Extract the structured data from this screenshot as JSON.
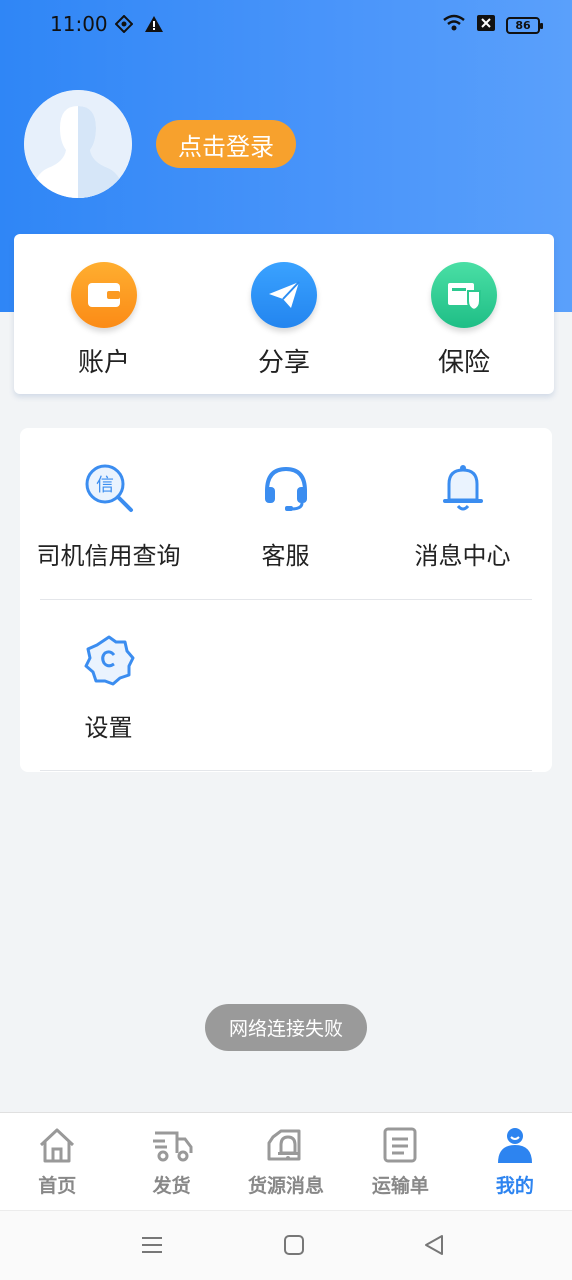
{
  "status_bar": {
    "time": "11:00",
    "battery": "86",
    "icons": [
      "location-icon",
      "warning-icon",
      "wifi-icon",
      "sim-off-icon",
      "battery-icon"
    ]
  },
  "profile": {
    "login_label": "点击登录"
  },
  "quick_actions": [
    {
      "label": "账户",
      "icon": "wallet-icon",
      "color": "#fb8b16"
    },
    {
      "label": "分享",
      "icon": "paper-plane-icon",
      "color": "#2385ef"
    },
    {
      "label": "保险",
      "icon": "insurance-shield-icon",
      "color": "#1fbe86"
    }
  ],
  "services": [
    {
      "label": "司机信用查询",
      "icon": "credit-search-icon",
      "badge": "信"
    },
    {
      "label": "客服",
      "icon": "headset-icon"
    },
    {
      "label": "消息中心",
      "icon": "bell-icon"
    },
    {
      "label": "设置",
      "icon": "settings-gear-icon"
    }
  ],
  "toast": "网络连接失败",
  "tabs": [
    {
      "label": "首页",
      "icon": "home-icon",
      "active": false
    },
    {
      "label": "发货",
      "icon": "truck-icon",
      "active": false
    },
    {
      "label": "货源消息",
      "icon": "cargo-notice-icon",
      "active": false
    },
    {
      "label": "运输单",
      "icon": "document-icon",
      "active": false
    },
    {
      "label": "我的",
      "icon": "user-icon",
      "active": true
    }
  ],
  "colors": {
    "primary": "#2d84f0",
    "login_button": "#f7a12d",
    "tab_inactive": "#888888"
  }
}
